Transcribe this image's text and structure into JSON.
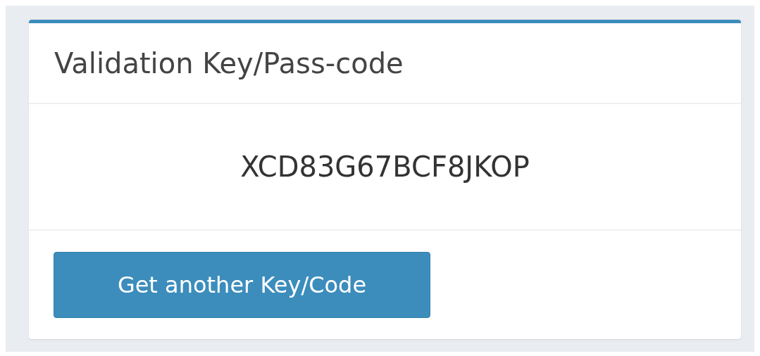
{
  "card": {
    "title": "Validation Key/Pass-code",
    "code": "XCD83G67BCF8JKOP",
    "button": "Get another Key/Code"
  }
}
